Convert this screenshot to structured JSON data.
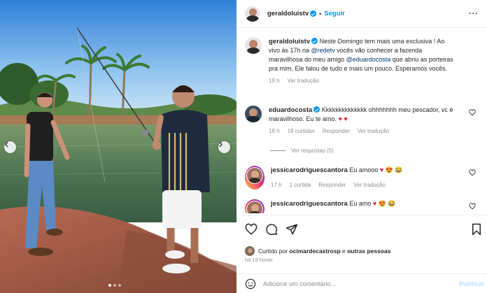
{
  "post": {
    "username": "geraldoluistv",
    "follow_label": "Seguir",
    "separator": "•",
    "more_label": "···",
    "caption_text": "Neste Domingo tem mais uma exclusiva ! Ao vivo às 17h na ",
    "caption_mention_1": "@redetv",
    "caption_text_2": " vocês vão conhecer a fazenda maravilhosa do meu amigo ",
    "caption_mention_2": "@eduardocosta",
    "caption_text_3": " que abriu as porteiras pra mim. Ele falou de tudo e mais um pouco. Esperamos vocês.",
    "caption_time": "19 h",
    "caption_translate": "Ver tradução",
    "carousel": {
      "slide_count": 3,
      "active_index": 0
    }
  },
  "comments": [
    {
      "username": "eduardocosta",
      "verified": true,
      "text": " Kkkkkkkkkkkkkk ohhhhhhh meu pescador, vc é maravilhoso. Eu te amo.",
      "emoji": "♥ ♥",
      "time": "18 h",
      "likes": "18 curtidas",
      "reply": "Responder",
      "translate": "Ver tradução",
      "view_replies": "Ver respostas (5)"
    },
    {
      "username": "jessicarodriguescantora",
      "text": " Eu amooo ",
      "emoji": "♥ 😍 😂",
      "time": "17 h",
      "likes": "1 curtida",
      "reply": "Responder",
      "translate": "Ver tradução"
    },
    {
      "username": "jessicarodriguescantora",
      "text": " Eu amo ",
      "emoji": "♥ 😍 😂"
    }
  ],
  "liked_by": {
    "prefix": "Curtido por ",
    "user": "ocimardecastrosp",
    "suffix": " e ",
    "others": "outras pessoas"
  },
  "post_time": "há 19 horas",
  "add_comment": {
    "placeholder": "Adicione um comentário...",
    "publish": "Publicar"
  },
  "colors": {
    "accent": "#0095f6",
    "mention": "#00376b",
    "heart": "#e01b3c",
    "muted": "#8e8e8e"
  }
}
